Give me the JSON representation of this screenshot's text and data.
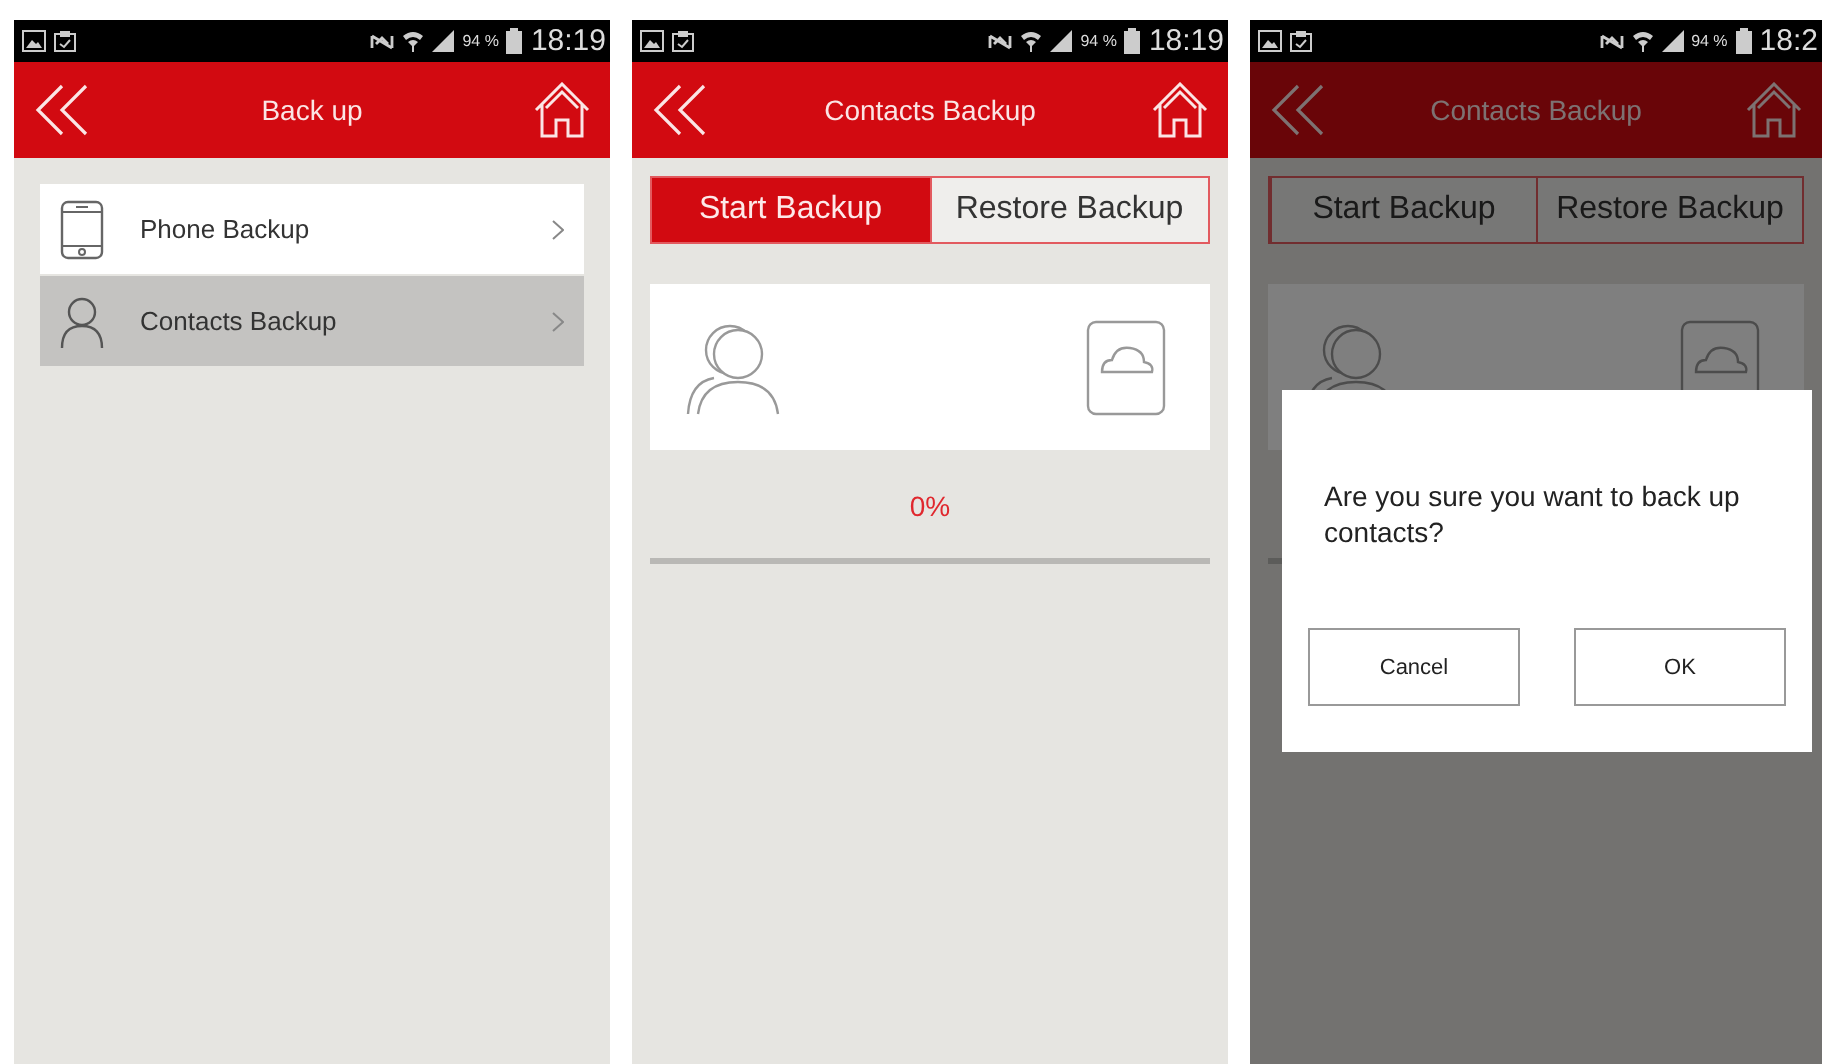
{
  "screens": [
    {
      "kind": "menu",
      "status_bar": {
        "battery": "94 %",
        "time": "18:19"
      },
      "header": {
        "title": "Back up"
      },
      "dimmed": false,
      "items": [
        {
          "label": "Phone Backup",
          "selected": false
        },
        {
          "label": "Contacts Backup",
          "selected": true
        }
      ]
    },
    {
      "kind": "backup",
      "status_bar": {
        "battery": "94 %",
        "time": "18:19"
      },
      "header": {
        "title": "Contacts Backup"
      },
      "dimmed": false,
      "tabs": [
        {
          "label": "Start Backup",
          "selected": true
        },
        {
          "label": "Restore Backup",
          "selected": false
        }
      ],
      "progress": {
        "text": "0%",
        "level": 0
      }
    },
    {
      "kind": "backup",
      "status_bar": {
        "battery": "94 %",
        "time": "18:2"
      },
      "header": {
        "title": "Contacts Backup"
      },
      "dimmed": true,
      "tabs": [
        {
          "label": "Start Backup",
          "selected": false
        },
        {
          "label": "Restore Backup",
          "selected": false
        }
      ],
      "progress": {
        "level": 0
      },
      "dialog": {
        "message": "Are you sure you want to back up contacts?",
        "buttons": [
          "Cancel",
          "OK"
        ]
      }
    }
  ]
}
